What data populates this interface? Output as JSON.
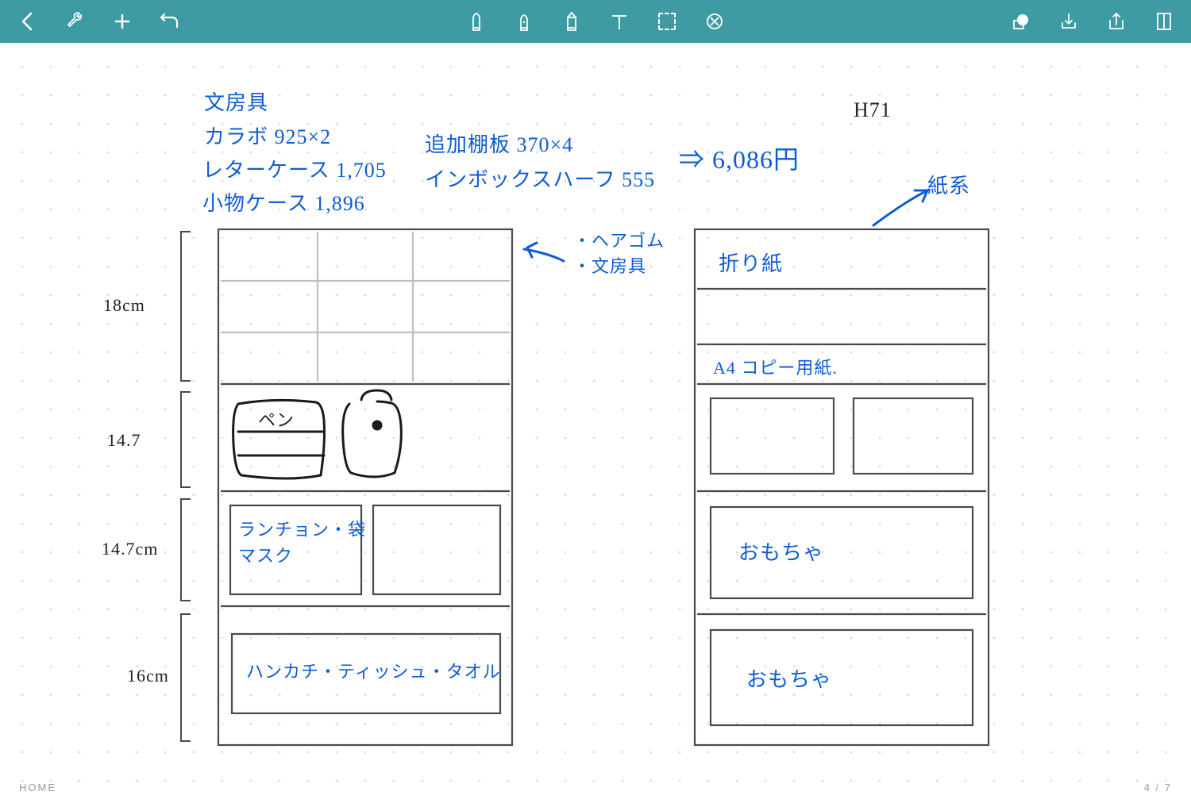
{
  "toolbar": {
    "selected_tool": "lasso"
  },
  "canvas": {
    "header": {
      "title": "文房具",
      "line2": "カラボ 925×2",
      "line3": "レターケース 1,705",
      "line4": "小物ケース 1,896",
      "col2a": "追加棚板 370×4",
      "col2b": "インボックスハーフ 555",
      "total_arrow": "⇒ 6,086円",
      "top_right": "H71",
      "paper_label": "紙系"
    },
    "left_shelf": {
      "dim1": "18cm",
      "dim2": "14.7",
      "dim3": "14.7cm",
      "dim4": "16cm",
      "note_arrow1": "・ヘアゴム",
      "note_arrow2": "・文房具",
      "pen_label": "ペン",
      "box3_label": "ランチョン・袋\nマスク",
      "box4_label": "ハンカチ・ティッシュ・タオル"
    },
    "right_shelf": {
      "row1": "折り紙",
      "row2": "A4 コピー用紙.",
      "row4": "おもちゃ",
      "row5": "おもちゃ"
    }
  },
  "footer": {
    "home": "HOME",
    "page": "4 / 7"
  }
}
